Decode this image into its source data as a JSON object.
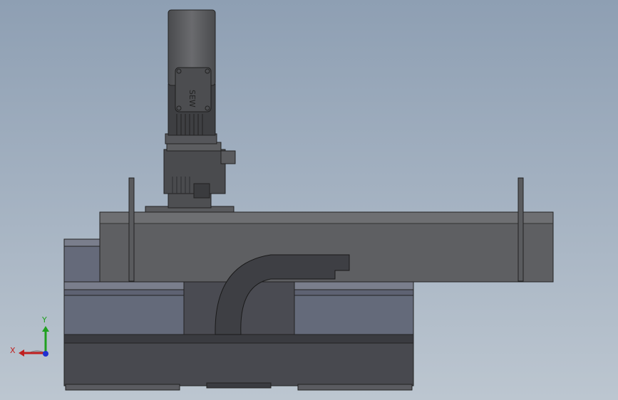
{
  "window": {
    "background_top": "#8e9fb3",
    "background_bottom": "#bcc6d0"
  },
  "model": {
    "motor_brand": "SEW",
    "shading_colors": {
      "dark": "#3d3f44",
      "medium": "#5a5b5e",
      "light": "#76787c",
      "blue_grey": "#656a7a"
    }
  },
  "triad": {
    "x_label": "X",
    "y_label": "Y",
    "x_color": "#c02020",
    "y_color": "#20a020",
    "z_color": "#2030d0"
  }
}
